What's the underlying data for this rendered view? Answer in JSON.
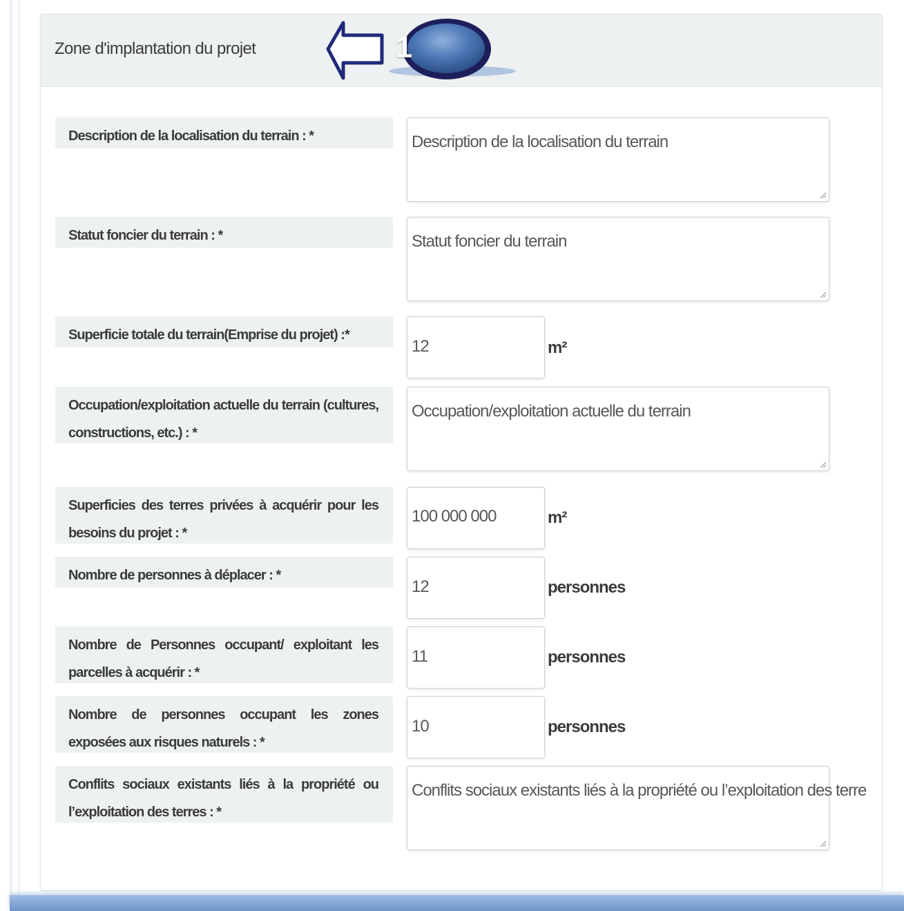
{
  "panel": {
    "title": "Zone d'implantation du projet",
    "step_badge": "1"
  },
  "fields": [
    {
      "label": "Description de la localisation du terrain : *",
      "type": "textarea",
      "placeholder": "Description de la localisation du terrain"
    },
    {
      "label": "Statut foncier du terrain : *",
      "type": "textarea",
      "placeholder": "Statut foncier du terrain"
    },
    {
      "label": "Superficie totale du terrain(Emprise du projet) :*",
      "type": "input",
      "value": "12",
      "unit": "m²"
    },
    {
      "label": "Occupation/exploitation actuelle du terrain (cultures, constructions, etc.) : *",
      "type": "textarea",
      "placeholder": "Occupation/exploitation actuelle du terrain"
    },
    {
      "label": "Superficies des terres privées à acquérir pour les besoins du projet : *",
      "type": "input",
      "value": "100 000 000",
      "unit": "m²"
    },
    {
      "label": "Nombre de personnes à déplacer : *",
      "type": "input",
      "value": "12",
      "unit": "personnes"
    },
    {
      "label": "Nombre de Personnes occupant/ exploitant les parcelles à acquérir : *",
      "type": "input",
      "value": "11",
      "unit": "personnes"
    },
    {
      "label": "Nombre de personnes occupant les zones exposées aux risques naturels : *",
      "type": "input",
      "value": "10",
      "unit": "personnes"
    },
    {
      "label": "Conflits sociaux existants liés à la propriété ou l’exploitation des terres : *",
      "type": "textarea",
      "placeholder": "Conflits sociaux existants liés à la propriété ou l’exploitation des terre"
    }
  ],
  "colors": {
    "header_bg": "#eef1f1",
    "label_bg": "#eef1f1",
    "badge_blue": "#3f6aa6",
    "arrow_navy": "#1f2a7a",
    "bottom_bar": "#7b9fd0"
  }
}
